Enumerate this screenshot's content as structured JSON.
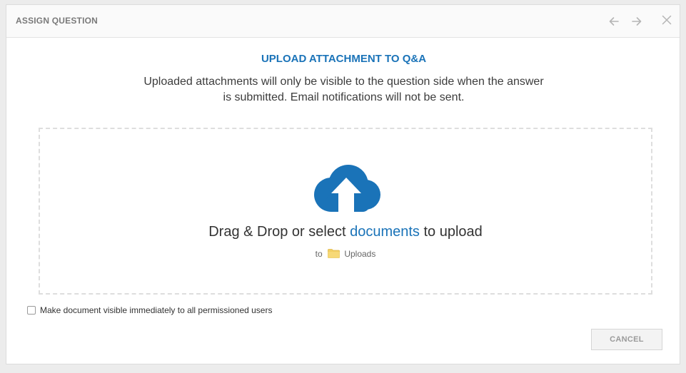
{
  "dialog": {
    "title": "ASSIGN QUESTION",
    "back_icon": "arrow-left-icon",
    "forward_icon": "arrow-right-icon",
    "close_icon": "close-icon"
  },
  "upload": {
    "heading": "UPLOAD ATTACHMENT TO Q&A",
    "description": "Uploaded attachments will only be visible to the question side when the answer is submitted. Email notifications will not be sent.",
    "drop_prefix": "Drag & Drop or select ",
    "drop_link": "documents",
    "drop_suffix": " to upload",
    "target_prefix": "to",
    "target_folder": "Uploads",
    "cloud_icon": "cloud-upload-icon",
    "folder_icon": "folder-icon"
  },
  "options": {
    "visible_immediately_label": "Make document visible immediately to all permissioned users",
    "visible_immediately_checked": false
  },
  "footer": {
    "cancel_label": "CANCEL"
  },
  "colors": {
    "accent": "#1a73b8",
    "folder": "#f2cf63"
  }
}
